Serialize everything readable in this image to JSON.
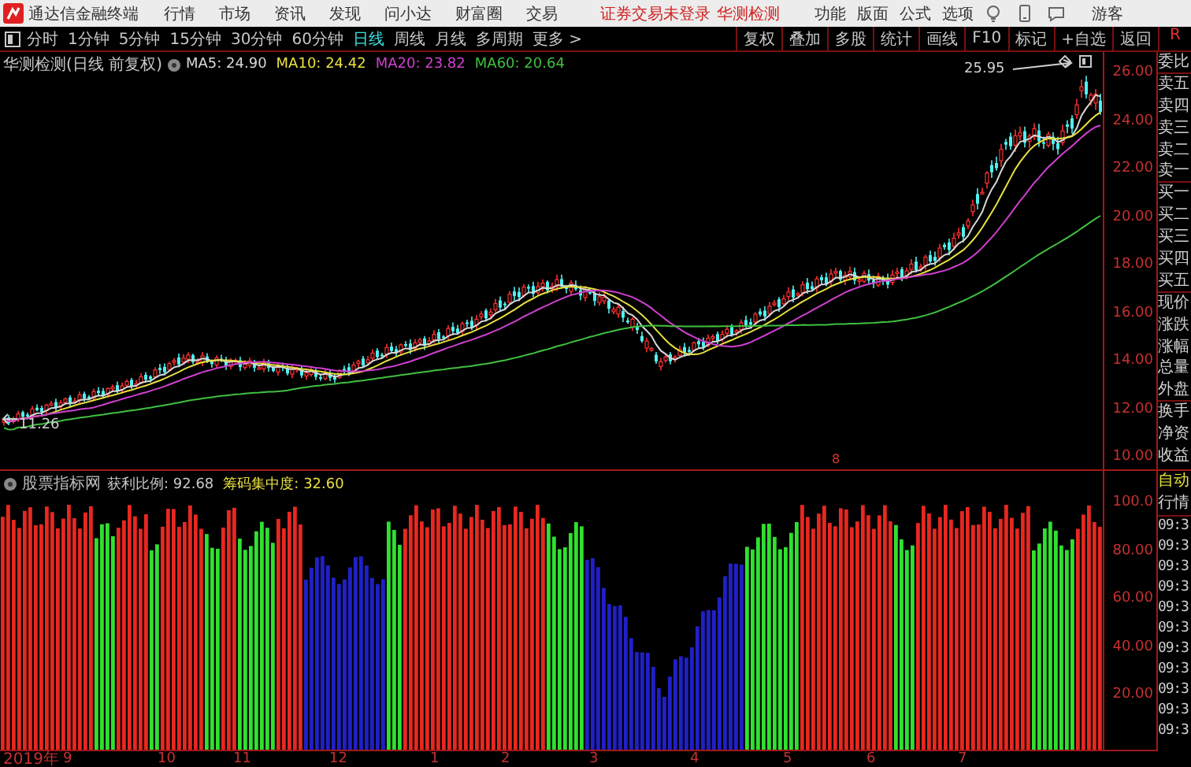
{
  "app": {
    "title": "通达信金融终端"
  },
  "menu": [
    "行情",
    "市场",
    "资讯",
    "发现",
    "问小达",
    "财富圈",
    "交易"
  ],
  "login_notice": "证券交易未登录",
  "stock_link": "华测检测",
  "right_menu": [
    "功能",
    "版面",
    "公式",
    "选项"
  ],
  "user": "游客",
  "periods": [
    {
      "label": "分时",
      "selected": false
    },
    {
      "label": "1分钟",
      "selected": false
    },
    {
      "label": "5分钟",
      "selected": false
    },
    {
      "label": "15分钟",
      "selected": false
    },
    {
      "label": "30分钟",
      "selected": false
    },
    {
      "label": "60分钟",
      "selected": false
    },
    {
      "label": "日线",
      "selected": true
    },
    {
      "label": "周线",
      "selected": false
    },
    {
      "label": "月线",
      "selected": false
    },
    {
      "label": "多周期",
      "selected": false
    },
    {
      "label": "更多 >",
      "selected": false
    }
  ],
  "tools": [
    "复权",
    "叠加",
    "多股",
    "统计",
    "画线",
    "F10",
    "标记",
    "+自选",
    "返回"
  ],
  "corner": "R",
  "chart": {
    "title": "华测检测(日线 前复权)",
    "ma": [
      {
        "text": "MA5: 24.90",
        "color": "#d8d8d8"
      },
      {
        "text": "MA10: 24.42",
        "color": "#e8e040"
      },
      {
        "text": "MA20: 23.82",
        "color": "#d040d0"
      },
      {
        "text": "MA60: 20.64",
        "color": "#40c040"
      }
    ],
    "price_ticks": [
      "26.00",
      "24.00",
      "22.00",
      "20.00",
      "18.00",
      "16.00",
      "14.00",
      "12.00",
      "10.00"
    ],
    "high_label": "25.95",
    "low_label": "11.26",
    "marker": "8"
  },
  "indicator": {
    "name": "股票指标网",
    "values": [
      {
        "text": "获利比例: 92.68",
        "color": "#c8c8c8"
      },
      {
        "text": "筹码集中度: 32.60",
        "color": "#e8e040"
      }
    ],
    "ticks": [
      "100.0",
      "80.00",
      "60.00",
      "40.00",
      "20.00"
    ]
  },
  "dates": [
    "2019年",
    "9",
    "10",
    "11",
    "12",
    "1",
    "2",
    "3",
    "4",
    "5",
    "6",
    "7"
  ],
  "side_panel": {
    "quote_labels": [
      "委比",
      "卖五",
      "卖四",
      "卖三",
      "卖二",
      "卖一",
      "买一",
      "买二",
      "买三",
      "买四",
      "买五",
      "现价",
      "涨跌",
      "涨幅",
      "总量",
      "外盘",
      "换手",
      "净资",
      "收益"
    ],
    "mode_label": "自动",
    "mode_sub": "行情",
    "times": [
      "09:3",
      "09:3",
      "09:3",
      "09:3",
      "09:3",
      "09:3",
      "09:3",
      "09:3",
      "09:3",
      "09:3",
      "09:3"
    ]
  }
}
